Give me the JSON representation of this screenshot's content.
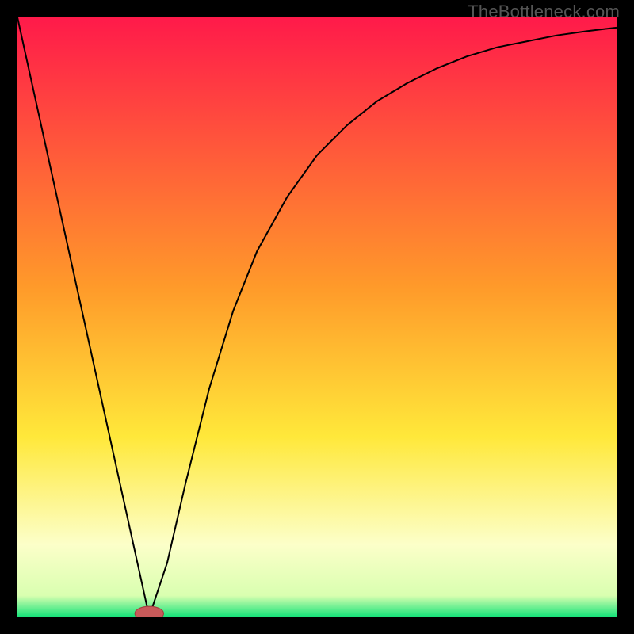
{
  "watermark": "TheBottleneck.com",
  "colors": {
    "bg": "#000000",
    "grad_top": "#ff1a4a",
    "grad_yellow": "#ffe83a",
    "grad_pale": "#fcffc9",
    "grad_green": "#18e37a",
    "curve": "#000000",
    "marker_fill": "#c85a5a",
    "marker_stroke": "#a43f3f"
  },
  "chart_data": {
    "type": "line",
    "title": "",
    "xlabel": "",
    "ylabel": "",
    "xlim": [
      0,
      100
    ],
    "ylim": [
      0,
      100
    ],
    "series": [
      {
        "name": "bottleneck-curve",
        "x": [
          0,
          22,
          25,
          28,
          32,
          36,
          40,
          45,
          50,
          55,
          60,
          65,
          70,
          75,
          80,
          85,
          90,
          95,
          100
        ],
        "y": [
          100,
          0,
          9,
          22,
          38,
          51,
          61,
          70,
          77,
          82,
          86,
          89,
          91.5,
          93.5,
          95,
          96,
          97,
          97.7,
          98.3
        ]
      }
    ],
    "marker": {
      "x": 22,
      "y": 0,
      "rx": 2.4,
      "ry": 1.2
    },
    "gradient_stops": [
      {
        "offset": 0.0,
        "color": "#ff1a4a"
      },
      {
        "offset": 0.45,
        "color": "#ff9a2a"
      },
      {
        "offset": 0.7,
        "color": "#ffe83a"
      },
      {
        "offset": 0.88,
        "color": "#fcffc9"
      },
      {
        "offset": 0.965,
        "color": "#d9ffb0"
      },
      {
        "offset": 1.0,
        "color": "#18e37a"
      }
    ]
  }
}
